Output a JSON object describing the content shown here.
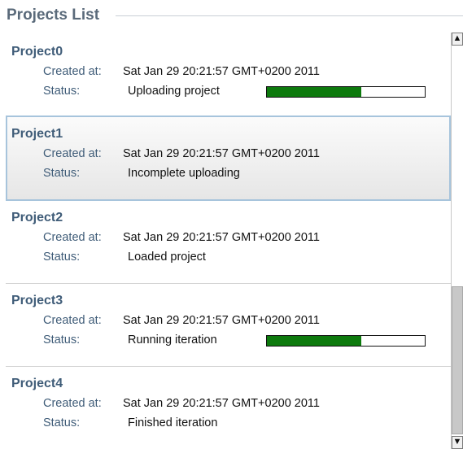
{
  "panel": {
    "title": "Projects List"
  },
  "labels": {
    "created": "Created at:",
    "status": "Status:"
  },
  "projects": [
    {
      "name": "Project0",
      "created": "Sat Jan 29 20:21:57 GMT+0200 2011",
      "status": "Uploading project",
      "progress": 0.6,
      "selected": false
    },
    {
      "name": "Project1",
      "created": "Sat Jan 29 20:21:57 GMT+0200 2011",
      "status": "Incomplete uploading",
      "progress": null,
      "selected": true
    },
    {
      "name": "Project2",
      "created": "Sat Jan 29 20:21:57 GMT+0200 2011",
      "status": "Loaded project",
      "progress": null,
      "selected": false
    },
    {
      "name": "Project3",
      "created": "Sat Jan 29 20:21:57 GMT+0200 2011",
      "status": "Running iteration",
      "progress": 0.6,
      "selected": false
    },
    {
      "name": "Project4",
      "created": "Sat Jan 29 20:21:57 GMT+0200 2011",
      "status": "Finished iteration",
      "progress": null,
      "selected": false
    }
  ],
  "scrollbar": {
    "up_icon": "arrow-up-icon",
    "down_icon": "arrow-down-icon",
    "up_glyph": "▲",
    "down_glyph": "▼"
  },
  "colors": {
    "progress_fill": "#0d7a0d",
    "title": "#5a6a7a",
    "name": "#3f5c78",
    "selected_border": "#a7c4dc"
  }
}
